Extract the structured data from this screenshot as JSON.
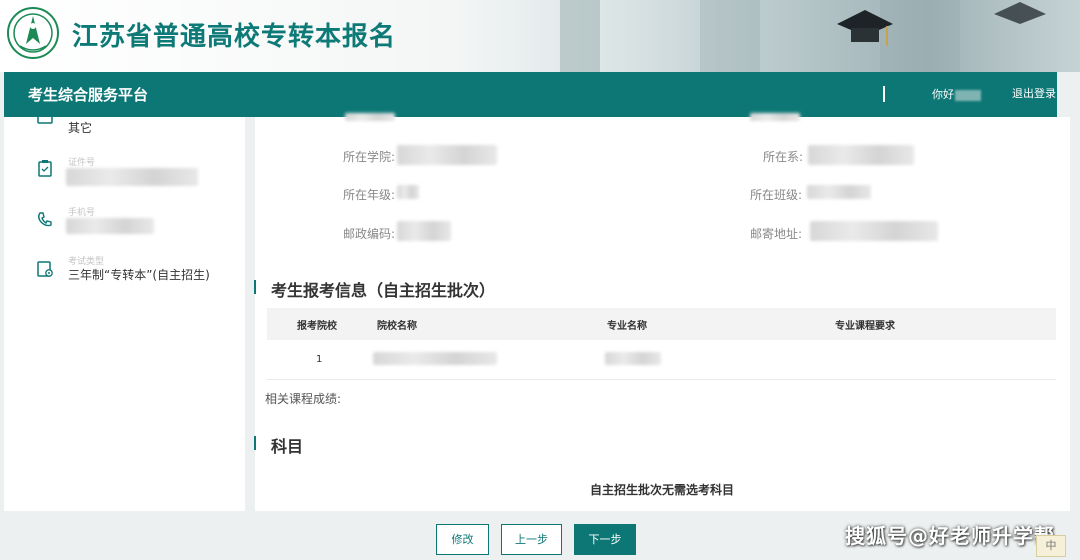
{
  "banner": {
    "title": "江苏省普通高校专转本报名",
    "logo_icon": "university-seal-icon"
  },
  "navbar": {
    "platform_title": "考生综合服务平台",
    "greeting": "你好",
    "logout_label": "退出登录"
  },
  "sidebar": {
    "items": [
      {
        "icon": "document-icon",
        "label": "",
        "value": "其它"
      },
      {
        "icon": "clipboard-icon",
        "label": "证件号",
        "value": ""
      },
      {
        "icon": "phone-icon",
        "label": "手机号",
        "value": ""
      },
      {
        "icon": "exam-type-icon",
        "label": "考试类型",
        "value": "三年制“专转本”(自主招生)"
      }
    ]
  },
  "info_fields": {
    "college_label": "所在学院:",
    "department_label": "所在系:",
    "grade_label": "所在年级:",
    "class_label": "所在班级:",
    "postcode_label": "邮政编码:",
    "address_label": "邮寄地址:"
  },
  "application": {
    "section_title": "考生报考信息（自主招生批次）",
    "columns": [
      "报考院校",
      "院校名称",
      "专业名称",
      "专业课程要求"
    ],
    "rows": [
      {
        "index": "1",
        "school_name": "",
        "major_name": "",
        "requirements": ""
      }
    ],
    "scores_label": "相关课程成绩:"
  },
  "subjects": {
    "section_title": "科目",
    "notice": "自主招生批次无需选考科目"
  },
  "buttons": {
    "modify": "修改",
    "prev": "上一步",
    "next": "下一步"
  },
  "watermark": "搜狐号@好老师升学帮",
  "ime_badge": "中",
  "colors": {
    "primary": "#0d7776",
    "title": "#0e7a77",
    "background": "#edf0f0"
  }
}
